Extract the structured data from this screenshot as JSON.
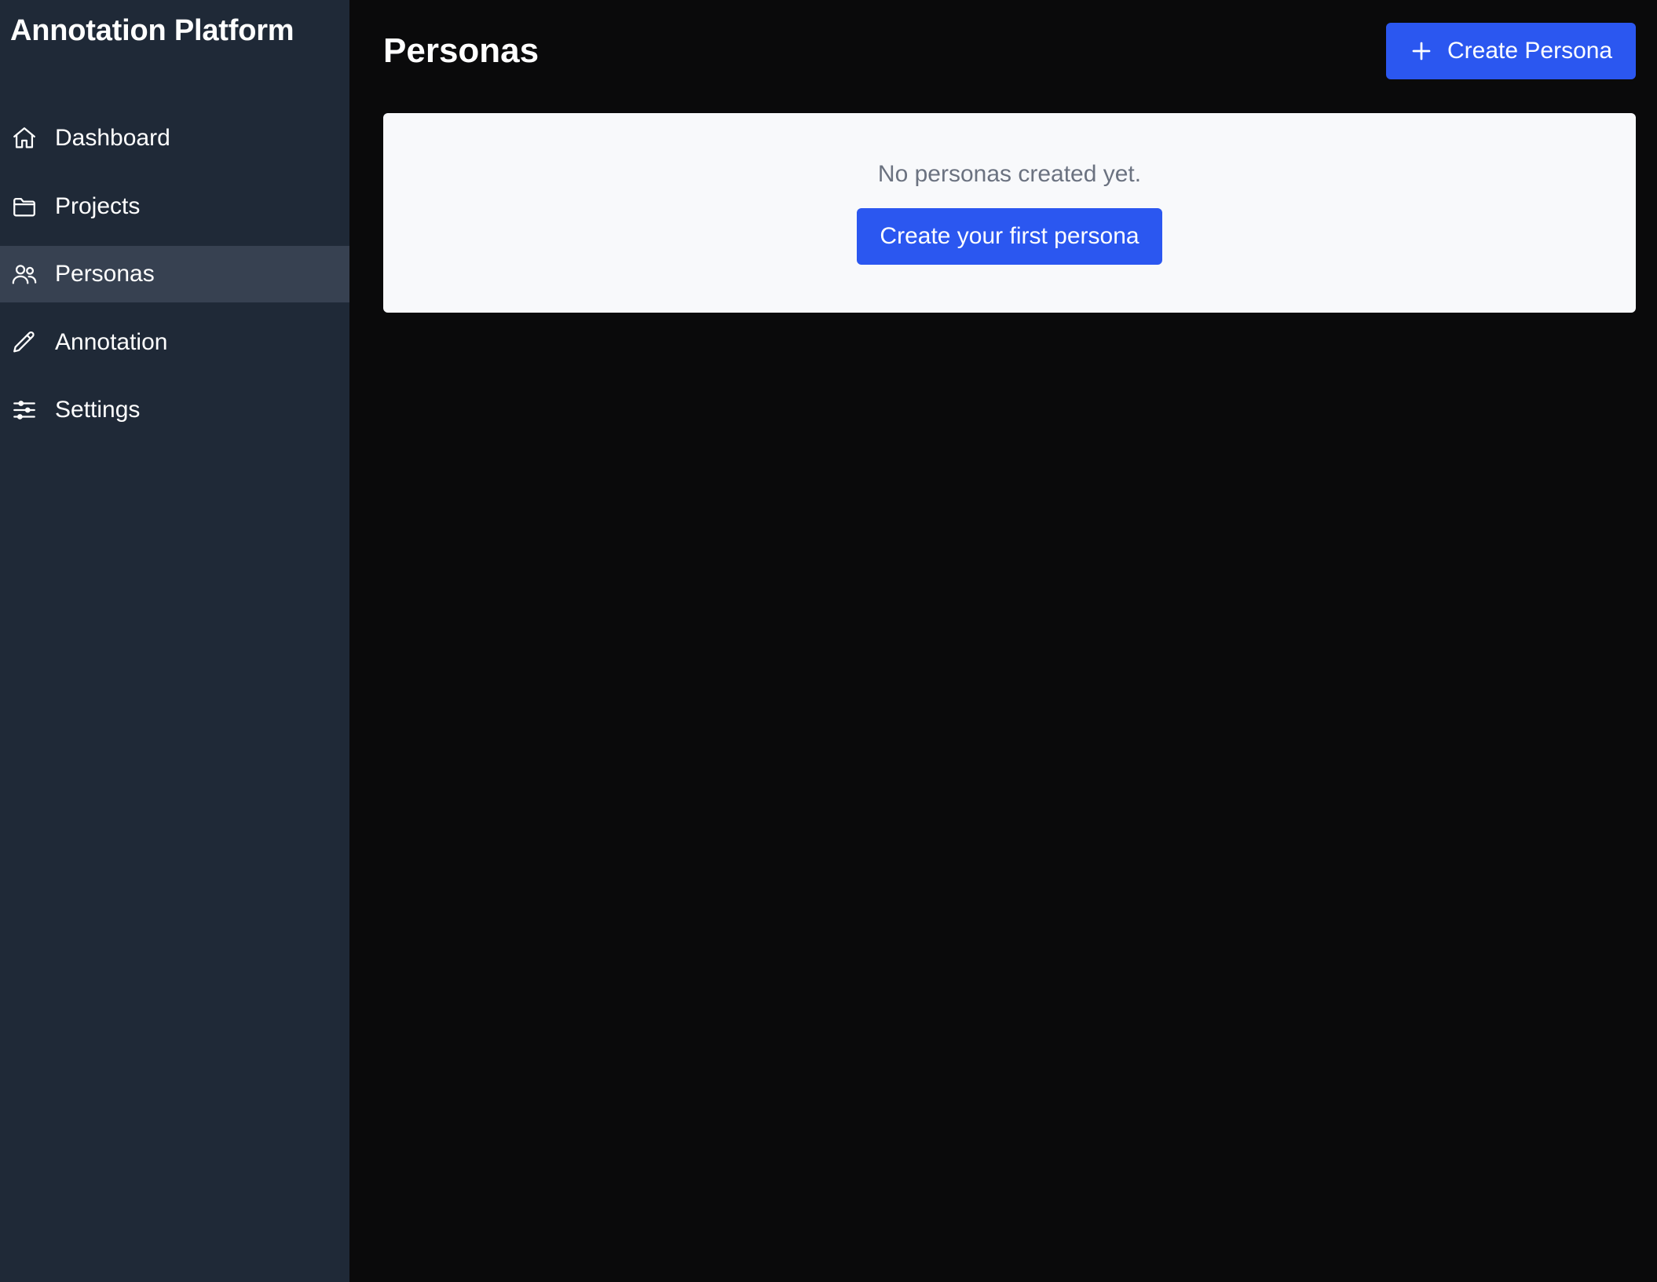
{
  "sidebar": {
    "brand": "Annotation Platform",
    "items": [
      {
        "label": "Dashboard",
        "icon": "home-icon",
        "active": false
      },
      {
        "label": "Projects",
        "icon": "folder-icon",
        "active": false
      },
      {
        "label": "Personas",
        "icon": "users-icon",
        "active": true
      },
      {
        "label": "Annotation",
        "icon": "pencil-icon",
        "active": false
      },
      {
        "label": "Settings",
        "icon": "sliders-icon",
        "active": false
      }
    ]
  },
  "header": {
    "title": "Personas",
    "create_label": "Create Persona",
    "create_icon": "plus-icon"
  },
  "empty_state": {
    "message": "No personas created yet.",
    "cta_label": "Create your first persona"
  },
  "colors": {
    "sidebar_bg": "#1f2937",
    "sidebar_active_bg": "#374151",
    "main_bg": "#0a0a0b",
    "primary": "#2b57f0",
    "card_bg": "#f8f9fb",
    "muted_text": "#6b7280"
  }
}
